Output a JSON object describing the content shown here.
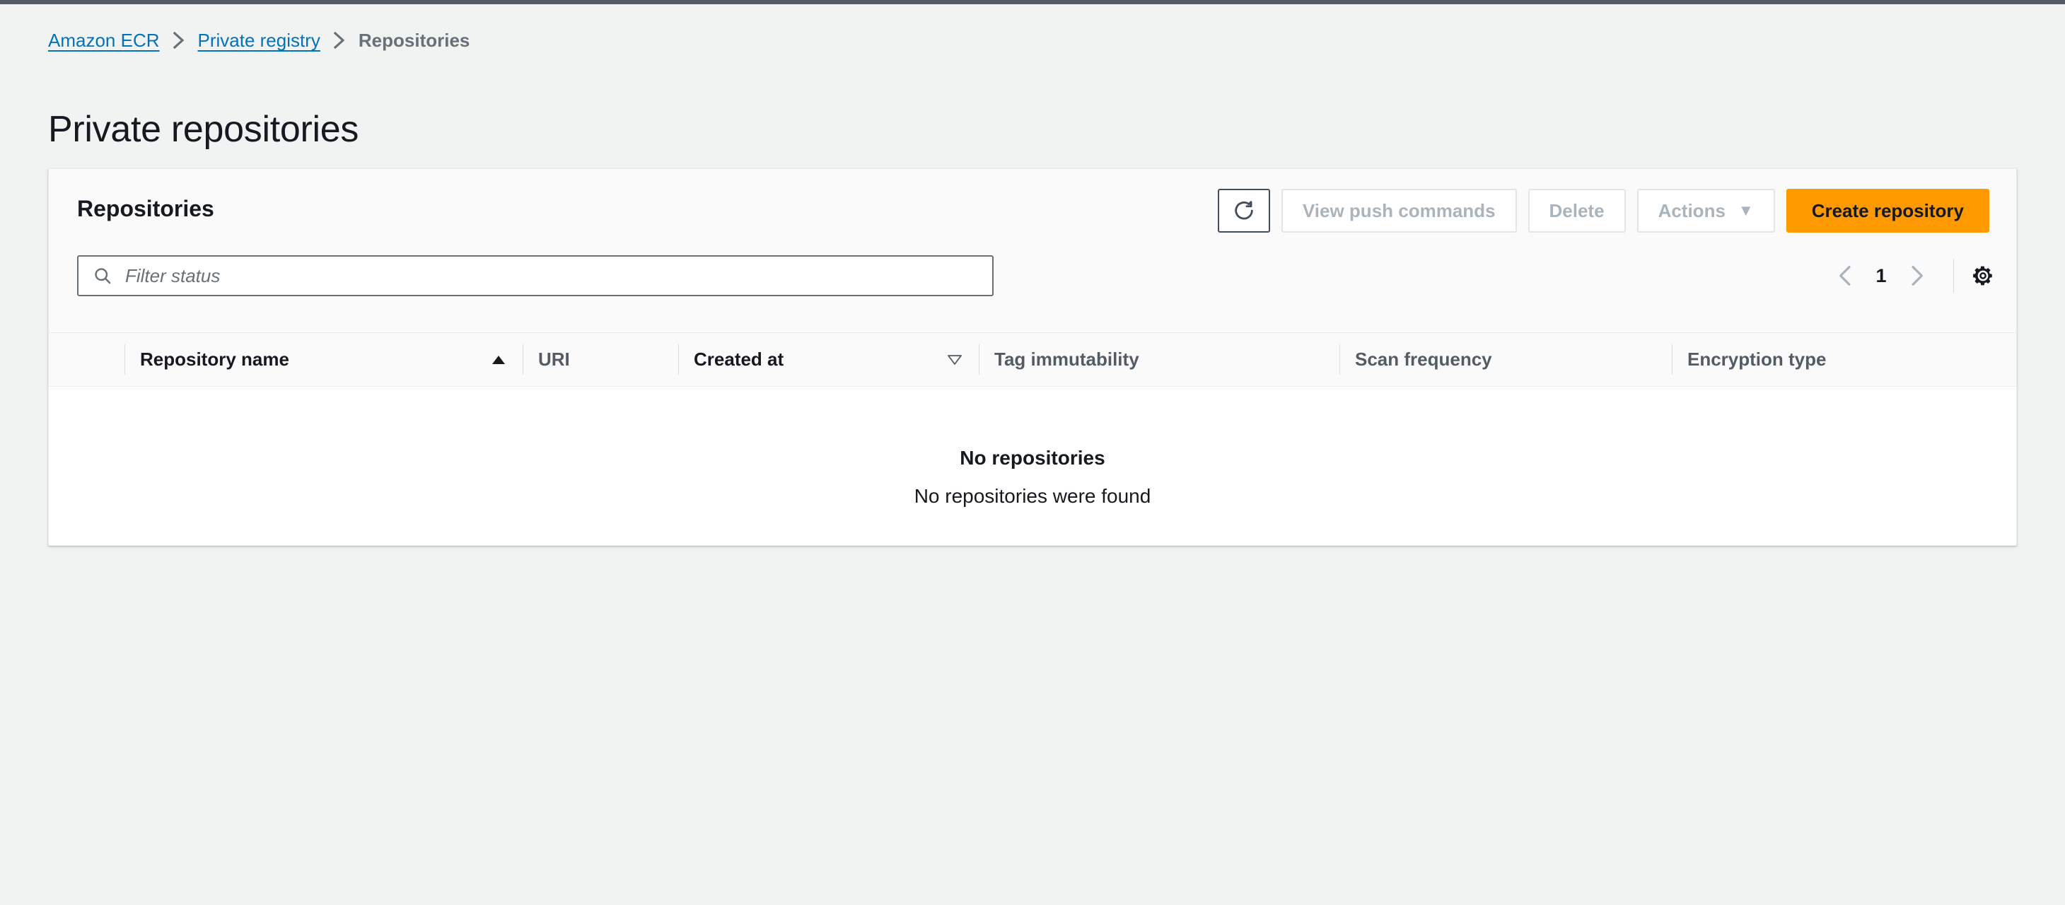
{
  "breadcrumb": {
    "items": [
      {
        "label": "Amazon ECR",
        "type": "link"
      },
      {
        "label": "Private registry",
        "type": "link"
      },
      {
        "label": "Repositories",
        "type": "current"
      }
    ],
    "separator": "›"
  },
  "page": {
    "title": "Private repositories"
  },
  "card": {
    "title": "Repositories"
  },
  "toolbar": {
    "refresh_icon": "refresh-icon",
    "view_push_commands_label": "View push commands",
    "delete_label": "Delete",
    "actions_label": "Actions",
    "actions_caret": "▼",
    "create_repository_label": "Create repository"
  },
  "filter": {
    "icon": "search-icon",
    "placeholder": "Filter status",
    "value": ""
  },
  "pagination": {
    "prev_icon": "chevron-left-icon",
    "next_icon": "chevron-right-icon",
    "current_page": "1",
    "settings_icon": "gear-icon"
  },
  "table": {
    "columns": [
      {
        "label": "",
        "name": "selection",
        "sort": "none",
        "active": false
      },
      {
        "label": "Repository name",
        "name": "repository-name",
        "sort": "asc",
        "active": true
      },
      {
        "label": "URI",
        "name": "uri",
        "sort": "none",
        "active": false
      },
      {
        "label": "Created at",
        "name": "created-at",
        "sort": "desc-outline",
        "active": true
      },
      {
        "label": "Tag immutability",
        "name": "tag-immutability",
        "sort": "none",
        "active": false
      },
      {
        "label": "Scan frequency",
        "name": "scan-frequency",
        "sort": "none",
        "active": false
      },
      {
        "label": "Encryption type",
        "name": "encryption-type",
        "sort": "none",
        "active": false
      }
    ],
    "rows": [],
    "empty_state": {
      "title": "No repositories",
      "subtitle": "No repositories were found"
    }
  },
  "colors": {
    "accent_orange": "#ff9900",
    "link_blue": "#0073bb",
    "text_dark": "#16191f",
    "text_muted": "#545b64",
    "disabled": "#aab4bd",
    "page_bg": "#f1f3f3",
    "top_strip": "#545b64"
  }
}
